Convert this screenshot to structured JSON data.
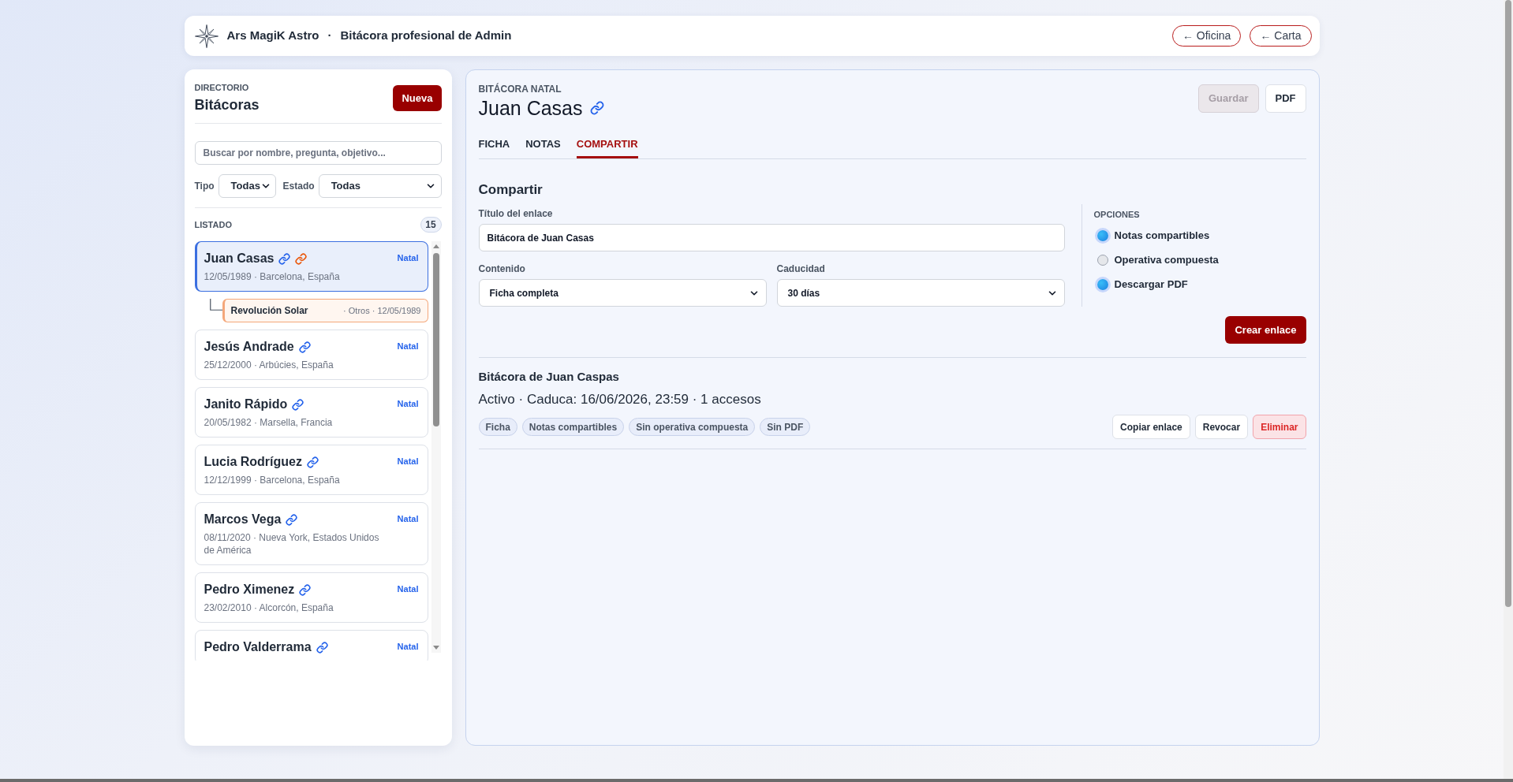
{
  "header": {
    "app_name": "Ars MagiK Astro",
    "separator": "·",
    "title": "Bitácora profesional de Admin",
    "nav_links": [
      {
        "label": "← Oficina"
      },
      {
        "label": "← Carta"
      }
    ]
  },
  "sidebar": {
    "eyebrow": "DIRECTORIO",
    "title": "Bitácoras",
    "new_button": "Nueva",
    "search": {
      "placeholder": "Buscar por nombre, pregunta, objetivo..."
    },
    "filters": [
      {
        "label": "Tipo",
        "value": "Todas"
      },
      {
        "label": "Estado",
        "value": "Todas"
      }
    ],
    "list_label": "LISTADO",
    "count": "15",
    "items": [
      {
        "name": "Juan Casas",
        "link_icons": [
          {
            "color": "#2563eb"
          },
          {
            "color": "#ea580c"
          }
        ],
        "type": "Natal",
        "details": "12/05/1989 · Barcelona, España",
        "selected": true,
        "children": [
          {
            "name": "Revolución Solar",
            "details": "· Otros · 12/05/1989"
          }
        ]
      },
      {
        "name": "Jesús Andrade",
        "link_icons": [
          {
            "color": "#2563eb"
          }
        ],
        "type": "Natal",
        "details": "25/12/2000 · Arbúcies, España",
        "selected": false
      },
      {
        "name": "Janito Rápido",
        "link_icons": [
          {
            "color": "#2563eb"
          }
        ],
        "type": "Natal",
        "details": "20/05/1982 · Marsella, Francia",
        "selected": false
      },
      {
        "name": "Lucia Rodríguez",
        "link_icons": [
          {
            "color": "#2563eb"
          }
        ],
        "type": "Natal",
        "details": "12/12/1999 · Barcelona, España",
        "selected": false
      },
      {
        "name": "Marcos Vega",
        "link_icons": [
          {
            "color": "#2563eb"
          }
        ],
        "type": "Natal",
        "details": "08/11/2020 · Nueva York, Estados Unidos de América",
        "selected": false
      },
      {
        "name": "Pedro Ximenez",
        "link_icons": [
          {
            "color": "#2563eb"
          }
        ],
        "type": "Natal",
        "details": "23/02/2010 · Alcorcón, España",
        "selected": false
      },
      {
        "name": "Pedro Valderrama",
        "link_icons": [
          {
            "color": "#2563eb"
          }
        ],
        "type": "Natal",
        "selected": false
      }
    ]
  },
  "record": {
    "eyebrow": "BITÁCORA NATAL",
    "title": "Juan Casas",
    "link_icons": [
      {
        "color": "#2563eb"
      }
    ],
    "actions": [
      {
        "label": "Guardar",
        "disabled": true
      },
      {
        "label": "PDF",
        "disabled": false
      }
    ],
    "tabs": [
      {
        "label": "FICHA",
        "selected": false
      },
      {
        "label": "NOTAS",
        "selected": false
      },
      {
        "label": "COMPARTIR",
        "selected": true
      }
    ],
    "share": {
      "heading": "Compartir",
      "title_field": {
        "label": "Título del enlace",
        "value": "Bitácora de Juan Casas"
      },
      "selects": [
        {
          "label": "Contenido",
          "value": "Ficha completa"
        },
        {
          "label": "Caducidad",
          "value": "30 días"
        }
      ],
      "options_label": "OPCIONES",
      "options": [
        {
          "label": "Notas compartibles",
          "checked": true
        },
        {
          "label": "Operativa compuesta",
          "checked": false
        },
        {
          "label": "Descargar PDF",
          "checked": true
        }
      ],
      "submit": "Crear enlace"
    },
    "links": [
      {
        "title": "Bitácora de Juan Caspas",
        "status": "Activo · Caduca: 16/06/2026, 23:59 · 1 accesos",
        "tags": [
          "Ficha",
          "Notas compartibles",
          "Sin operativa compuesta",
          "Sin PDF"
        ],
        "actions": [
          {
            "label": "Copiar enlace",
            "kind": "default"
          },
          {
            "label": "Revocar",
            "kind": "default"
          },
          {
            "label": "Eliminar",
            "kind": "danger"
          }
        ]
      }
    ]
  }
}
